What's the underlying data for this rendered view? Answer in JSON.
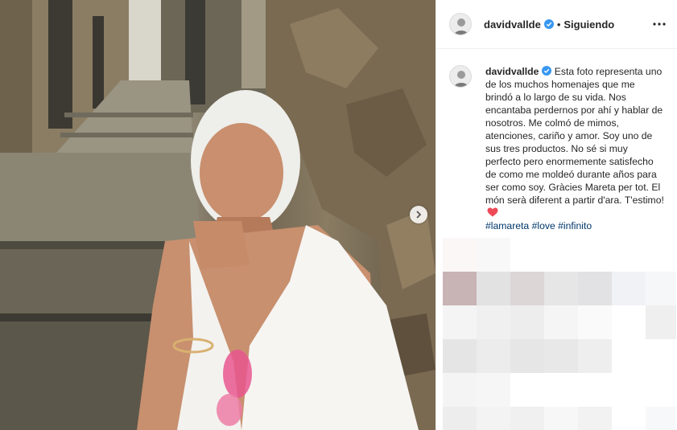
{
  "post": {
    "image_alt": "",
    "carousel": {
      "next_icon": "chevron-right-icon"
    }
  },
  "header": {
    "username": "davidvallde",
    "separator": "•",
    "follow_status": "Siguiendo",
    "more_icon": "more-horizontal-icon"
  },
  "caption": {
    "username": "davidvallde",
    "text": "Esta foto representa uno de los muchos homenajes que me brindó a lo largo de su vida. Nos encantaba perdernos por ahí y hablar de nosotros. Me colmó de mimos, atenciones, cariño y amor. Soy uno de sus tres productos. No sé si muy perfecto pero enormemente satisfecho de como me moldeó durante años para ser como soy. Gràcies Mareta per tot. El món serà diferent a partir d'ara. T'estimo!",
    "hashtags": [
      "#lamareta",
      "#love",
      "#infinito"
    ]
  },
  "colors": {
    "verified": "#3897f0",
    "heart": "#ed4956",
    "hashtag": "#00376b"
  }
}
